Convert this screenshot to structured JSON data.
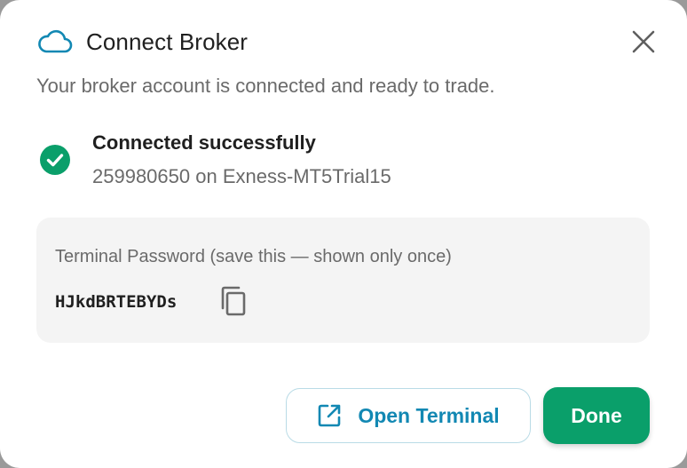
{
  "dialog": {
    "title": "Connect Broker",
    "subtitle": "Your broker account is connected and ready to trade.",
    "icon": "cloud-icon",
    "close_icon": "close-icon"
  },
  "status": {
    "icon": "check-circle-icon",
    "title": "Connected successfully",
    "detail": "259980650 on Exness-MT5Trial15"
  },
  "password": {
    "label": "Terminal Password (save this — shown only once)",
    "value": "HJkdBRTEBYDs",
    "copy_icon": "copy-icon"
  },
  "actions": {
    "open_terminal_label": "Open Terminal",
    "open_terminal_icon": "external-link-icon",
    "done_label": "Done"
  },
  "colors": {
    "accent_blue": "#1288b3",
    "success_green": "#0a9f6a"
  }
}
